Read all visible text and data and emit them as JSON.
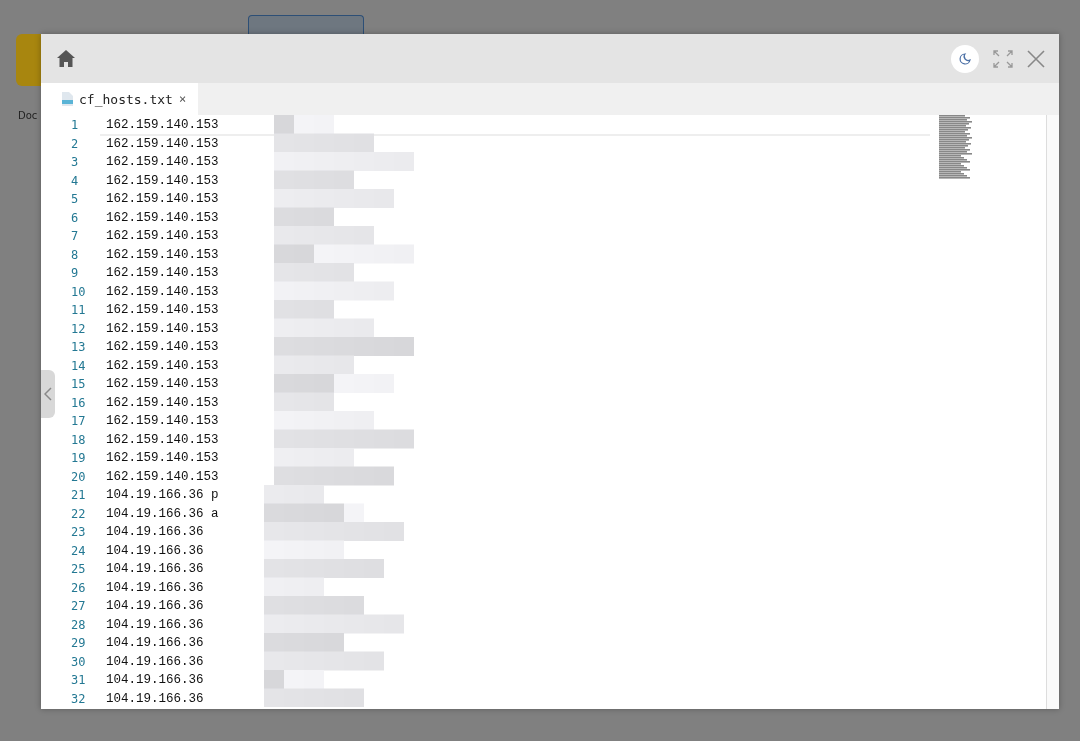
{
  "desktop": {
    "items": [
      {
        "label": "Doc"
      }
    ]
  },
  "window": {
    "tabs": [
      {
        "label": "cf_hosts.txt",
        "close": "×",
        "selected": true
      }
    ],
    "dark_mode": false
  },
  "editor": {
    "lines": [
      {
        "number": "1",
        "text": "162.159.140.153"
      },
      {
        "number": "2",
        "text": "162.159.140.153"
      },
      {
        "number": "3",
        "text": "162.159.140.153"
      },
      {
        "number": "4",
        "text": "162.159.140.153"
      },
      {
        "number": "5",
        "text": "162.159.140.153"
      },
      {
        "number": "6",
        "text": "162.159.140.153"
      },
      {
        "number": "7",
        "text": "162.159.140.153"
      },
      {
        "number": "8",
        "text": "162.159.140.153"
      },
      {
        "number": "9",
        "text": "162.159.140.153"
      },
      {
        "number": "10",
        "text": "162.159.140.153"
      },
      {
        "number": "11",
        "text": "162.159.140.153"
      },
      {
        "number": "12",
        "text": "162.159.140.153"
      },
      {
        "number": "13",
        "text": "162.159.140.153"
      },
      {
        "number": "14",
        "text": "162.159.140.153"
      },
      {
        "number": "15",
        "text": "162.159.140.153"
      },
      {
        "number": "16",
        "text": "162.159.140.153"
      },
      {
        "number": "17",
        "text": "162.159.140.153"
      },
      {
        "number": "18",
        "text": "162.159.140.153"
      },
      {
        "number": "19",
        "text": "162.159.140.153"
      },
      {
        "number": "20",
        "text": "162.159.140.153"
      },
      {
        "number": "21",
        "text": "104.19.166.36 p"
      },
      {
        "number": "22",
        "text": "104.19.166.36 a"
      },
      {
        "number": "23",
        "text": "104.19.166.36"
      },
      {
        "number": "24",
        "text": "104.19.166.36"
      },
      {
        "number": "25",
        "text": "104.19.166.36"
      },
      {
        "number": "26",
        "text": "104.19.166.36"
      },
      {
        "number": "27",
        "text": "104.19.166.36"
      },
      {
        "number": "28",
        "text": "104.19.166.36"
      },
      {
        "number": "29",
        "text": "104.19.166.36"
      },
      {
        "number": "30",
        "text": "104.19.166.36"
      },
      {
        "number": "31",
        "text": "104.19.166.36"
      },
      {
        "number": "32",
        "text": "104.19.166.36"
      }
    ]
  }
}
